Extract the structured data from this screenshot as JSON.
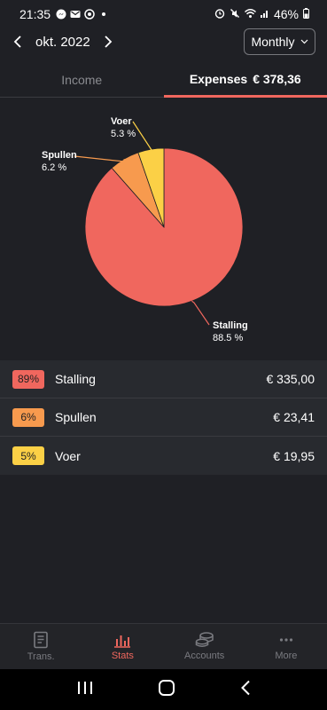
{
  "status_bar": {
    "time": "21:35",
    "battery": "46%"
  },
  "header": {
    "period": "okt. 2022",
    "view_mode": "Monthly"
  },
  "tabs": [
    {
      "label": "Income",
      "amount": ""
    },
    {
      "label": "Expenses",
      "amount": "€ 378,36"
    }
  ],
  "chart_data": {
    "type": "pie",
    "slices": [
      {
        "label": "Stalling",
        "value": 88.5,
        "value_label": "88.5 %",
        "color": "#f0675e"
      },
      {
        "label": "Spullen",
        "value": 6.2,
        "value_label": "6.2 %",
        "color": "#f79a4e"
      },
      {
        "label": "Voer",
        "value": 5.3,
        "value_label": "5.3 %",
        "color": "#fbd046"
      }
    ]
  },
  "categories": [
    {
      "percent": "89%",
      "name": "Stalling",
      "amount": "€ 335,00",
      "color": "#f0675e"
    },
    {
      "percent": "6%",
      "name": "Spullen",
      "amount": "€ 23,41",
      "color": "#f79a4e"
    },
    {
      "percent": "5%",
      "name": "Voer",
      "amount": "€ 19,95",
      "color": "#fbd046"
    }
  ],
  "bottom_nav": [
    {
      "label": "Trans.",
      "icon": "book-icon"
    },
    {
      "label": "Stats",
      "icon": "bar-chart-icon"
    },
    {
      "label": "Accounts",
      "icon": "coins-icon"
    },
    {
      "label": "More",
      "icon": "more-icon"
    }
  ]
}
